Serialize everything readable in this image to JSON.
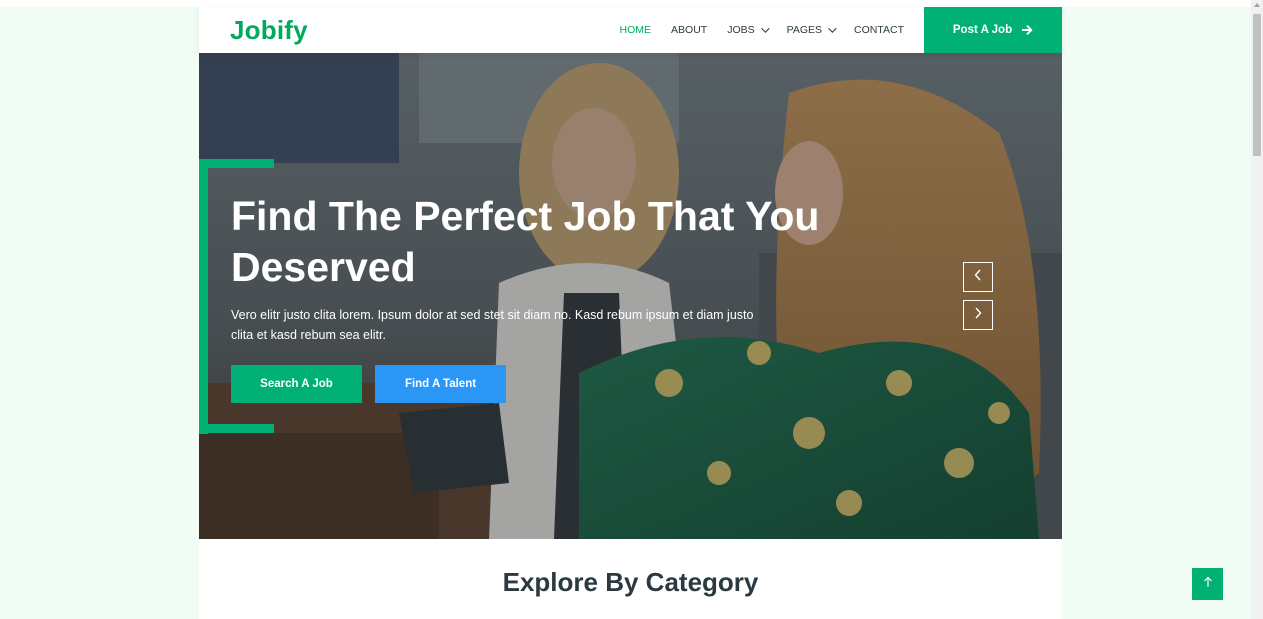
{
  "brand": {
    "name": "Jobify",
    "color": "#00a95c"
  },
  "nav": {
    "items": [
      {
        "label": "HOME",
        "active": true,
        "dropdown": false
      },
      {
        "label": "ABOUT",
        "active": false,
        "dropdown": false
      },
      {
        "label": "JOBS",
        "active": false,
        "dropdown": true
      },
      {
        "label": "PAGES",
        "active": false,
        "dropdown": true
      },
      {
        "label": "CONTACT",
        "active": false,
        "dropdown": false
      }
    ],
    "post_button": {
      "label": "Post A Job",
      "icon": "arrow-right-icon"
    }
  },
  "hero": {
    "title": "Find The Perfect Job That You Deserved",
    "text": "Vero elitr justo clita lorem. Ipsum dolor at sed stet sit diam no. Kasd rebum ipsum et diam justo clita et kasd rebum sea elitr.",
    "search_button": "Search A Job",
    "talent_button": "Find A Talent",
    "prev_icon": "chevron-left-icon",
    "next_icon": "chevron-right-icon"
  },
  "section": {
    "title": "Explore By Category"
  },
  "back_to_top": {
    "icon": "arrow-up-icon"
  },
  "colors": {
    "primary": "#00b074",
    "secondary": "#2a97f6",
    "dark": "#2b3940",
    "page_background": "#f1fcf4"
  }
}
